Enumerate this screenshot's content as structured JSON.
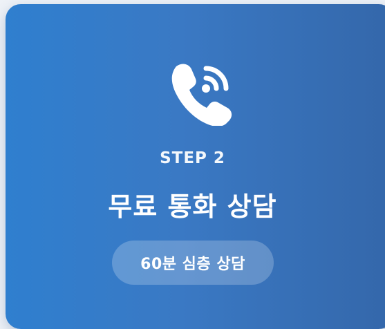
{
  "card": {
    "icon": "phone-call-icon",
    "step_label": "STEP 2",
    "title": "무료 통화 상담",
    "badge_label": "60분 심층 상담"
  },
  "colors": {
    "gradient_start": "#2f7fcf",
    "gradient_end": "#3467aa",
    "text": "#ffffff"
  }
}
